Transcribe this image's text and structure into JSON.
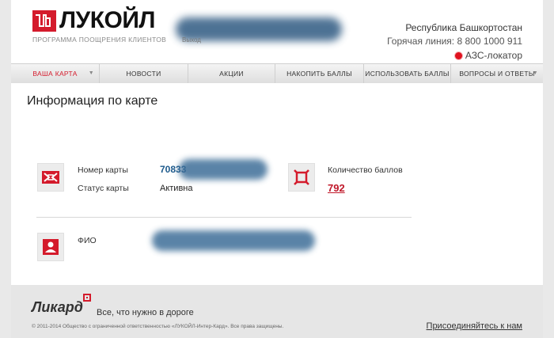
{
  "header": {
    "logo_text": "ЛУКОЙЛ",
    "subtitle": "ПРОГРАММА ПООЩРЕНИЯ КЛИЕНТОВ",
    "user_small": "Выход",
    "region": "Республика Башкортостан",
    "hotline": "Горячая линия: 8 800 1000 911",
    "azs_locator": "АЗС-локатор"
  },
  "nav": {
    "items": [
      {
        "label": "ВАША КАРТА"
      },
      {
        "label": "НОВОСТИ"
      },
      {
        "label": "АКЦИИ"
      },
      {
        "label": "НАКОПИТЬ БАЛЛЫ"
      },
      {
        "label": "ИСПОЛЬЗОВАТЬ БАЛЛЫ"
      },
      {
        "label": "ВОПРОСЫ И ОТВЕТЫ"
      }
    ]
  },
  "main": {
    "title": "Информация по карте",
    "card_number_label": "Номер карты",
    "card_number_value": "70833",
    "card_status_label": "Статус карты",
    "card_status_value": "Активна",
    "points_label": "Количество баллов",
    "points_value": "792",
    "fio_label": "ФИО"
  },
  "footer": {
    "brand": "Ликард",
    "slogan": "Все, что нужно в дороге",
    "copyright": "© 2011-2014 Общество с ограниченной ответственностью «ЛУКОЙЛ-Интер-Кард». Все права защищены.",
    "join_link": "Присоединяйтесь к нам"
  },
  "colors": {
    "brand_red": "#d41b2c",
    "card_number_blue": "#1d5a8c",
    "nav_bg": "#e6e6e6",
    "footer_bg": "#e6e6e6"
  },
  "icons": {
    "card_icon": "card-icon",
    "points_icon": "points-icon",
    "user_icon": "user-icon",
    "location_icon": "location-dot-icon"
  }
}
